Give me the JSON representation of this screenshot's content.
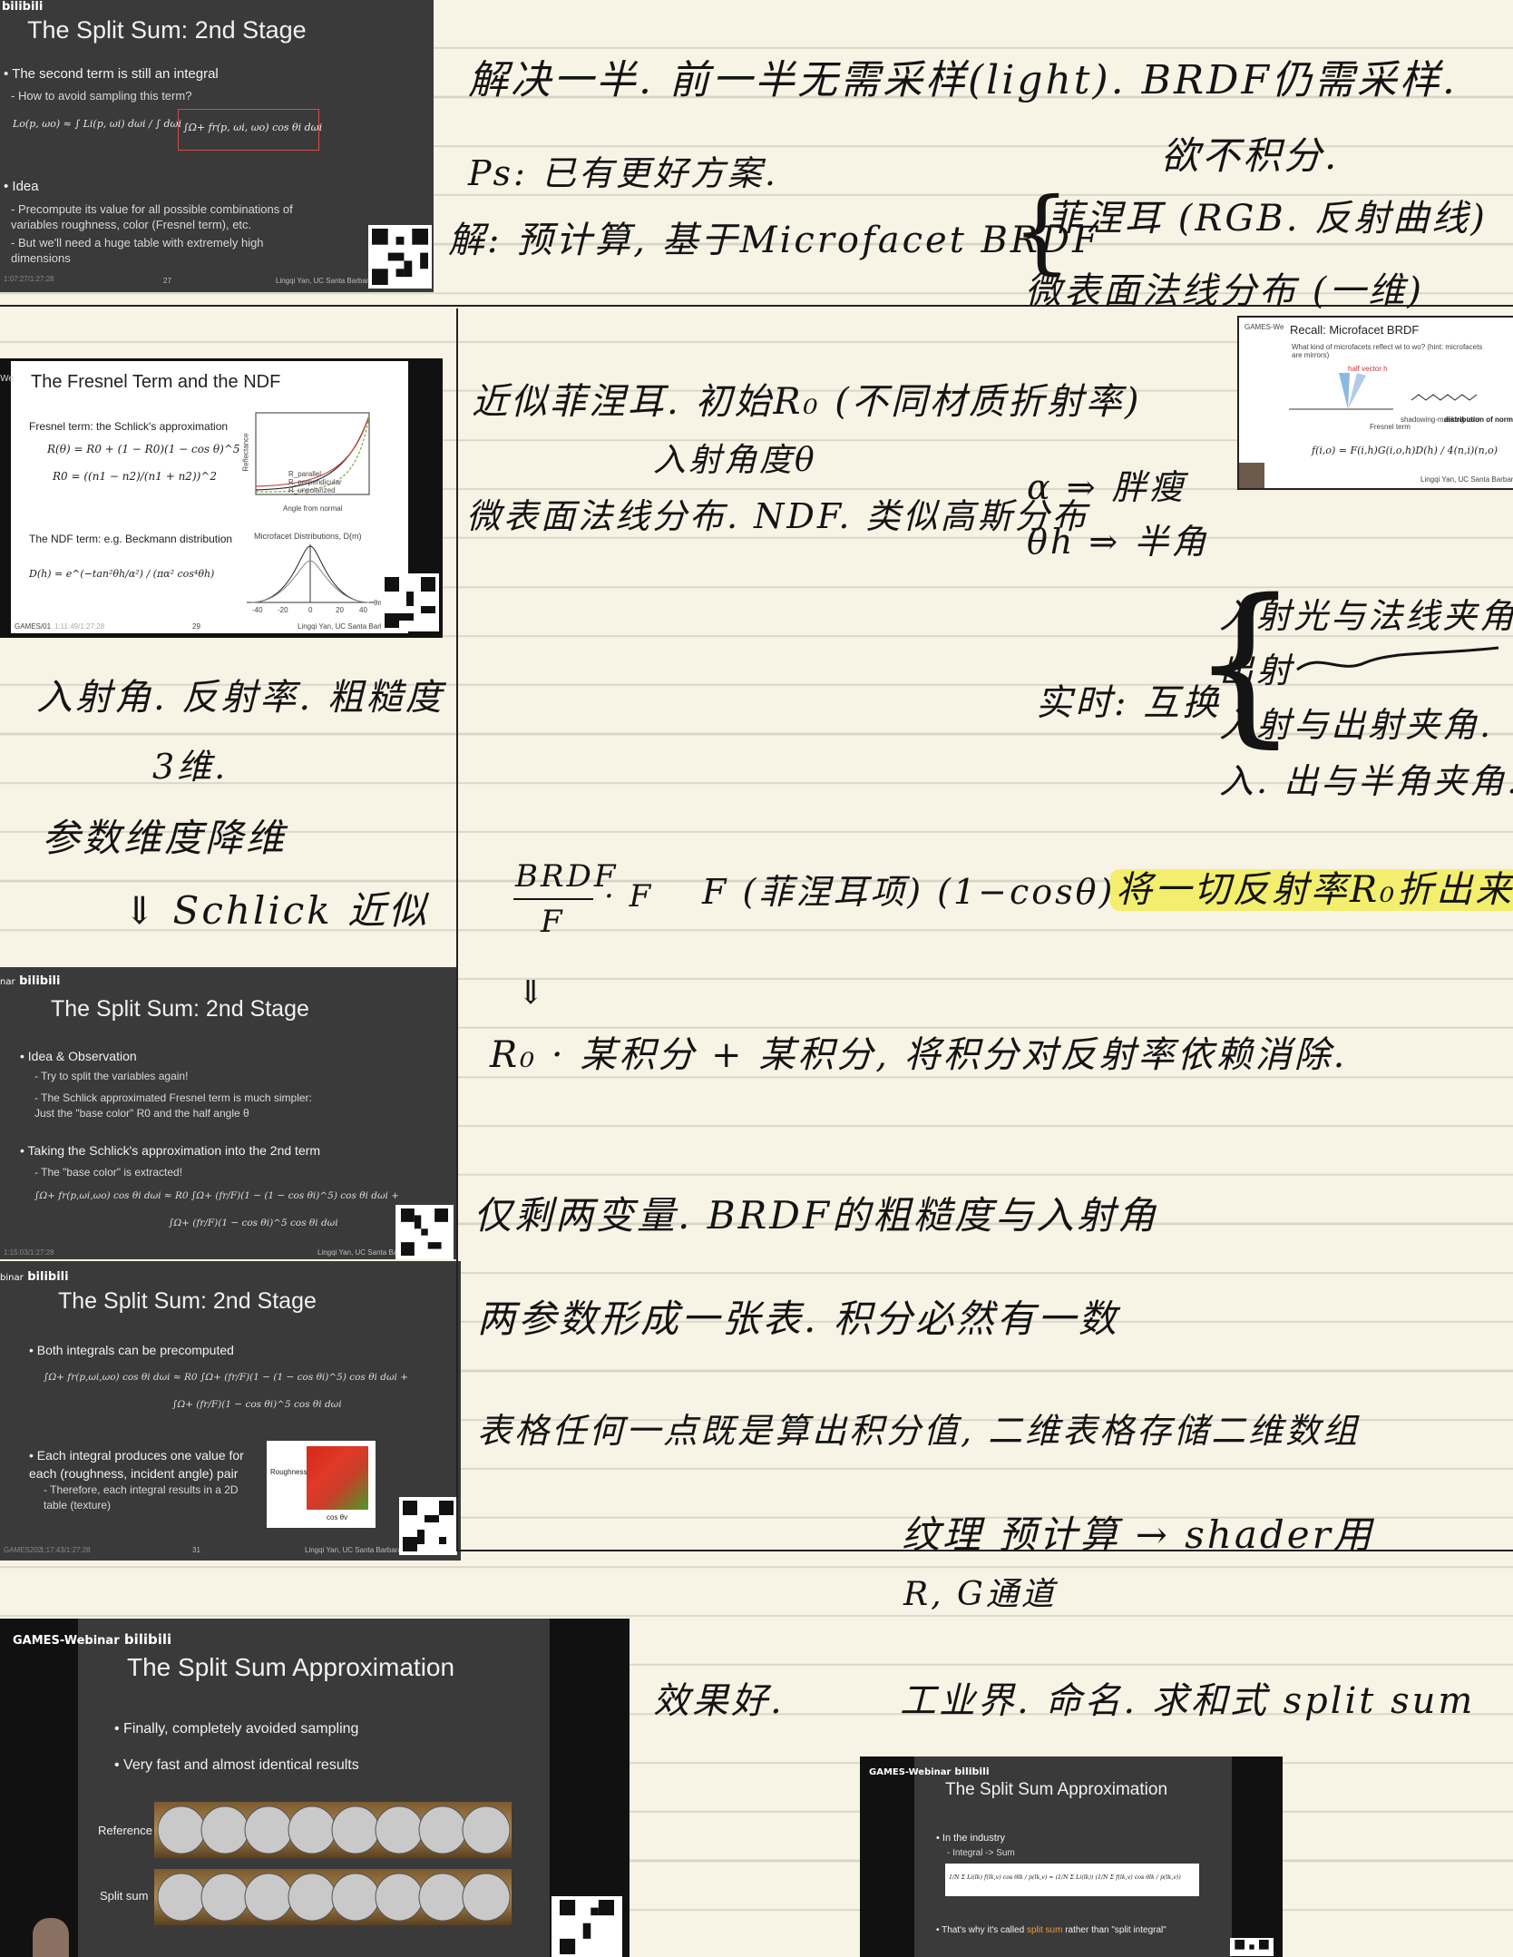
{
  "slides": {
    "s1": {
      "logo": "bilibili",
      "title": "The Split Sum: 2nd Stage",
      "b1": "The second term is still an integral",
      "b1a": "How to avoid sampling this term?",
      "formula_left": "Lo(p, ωo) ≈ ∫ Li(p, ωi) dωi / ∫ dωi",
      "formula_boxed": "∫Ω+ fr(p, ωi, ωo) cos θi dωi",
      "b2": "Idea",
      "b2a": "Precompute its value for all possible combinations of variables roughness, color (Fresnel term), etc.",
      "b2b": "But we'll need a huge table with extremely high dimensions",
      "page": "27",
      "footer": "Lingqi Yan, UC Santa Barbara",
      "time": "1:07:27/1:27:28"
    },
    "s2": {
      "title": "The Fresnel Term and the NDF",
      "fres_label": "Fresnel term: the Schlick's approximation",
      "fres_formula": "R(θ) = R0 + (1 − R0)(1 − cos θ)^5",
      "r0_formula": "R0 = ((n1 − n2)/(n1 + n2))^2",
      "ndf_label": "The NDF term: e.g. Beckmann distribution",
      "ndf_formula": "D(h) = e^(−tan²θh/α²) / (πα² cos⁴θh)",
      "plot1_legend": [
        "R_parallel",
        "R_perpendicular",
        "R_unpolarized"
      ],
      "plot1_xlabel": "Angle from normal",
      "plot1_ylabel": "Reflectance",
      "plot2_title": "Microfacet Distributions, D(m)",
      "plot2_ticks": [
        "-40",
        "-20",
        "0",
        "20",
        "40"
      ],
      "plot2_xlabel": "θm",
      "page": "29",
      "footer": "Lingqi Yan, UC Santa Barbara",
      "left_label": "We",
      "tag": "GAMES/01",
      "time": "1:11:49/1:27:28"
    },
    "s3": {
      "tag": "GAMES-We",
      "title": "Recall: Microfacet BRDF",
      "b1": "What kind of microfacets reflect wi to wo? (hint: microfacets are mirrors)",
      "hv": "half vector h",
      "labels": [
        "Fresnel term",
        "shadowing-masking term",
        "distribution of normals"
      ],
      "formula": "f(i,o) = F(i,h)G(i,o,h)D(h) / 4(n,i)(n,o)",
      "footer": "Lingqi Yan, UC Santa Barbara"
    },
    "s4": {
      "logo": "bilibili",
      "logo_prefix": "nar",
      "title": "The Split Sum: 2nd Stage",
      "b1": "Idea & Observation",
      "b1a": "Try to split the variables again!",
      "b1b": "The Schlick approximated Fresnel term is much simpler: Just the \"base color\" R0 and the half angle θ",
      "b2": "Taking the Schlick's approximation into the 2nd term",
      "b2a": "The \"base color\" is extracted!",
      "formula1": "∫Ω+ fr(p,ωi,ωo) cos θi dωi ≈ R0 ∫Ω+ (fr/F)(1 − (1 − cos θi)^5) cos θi dωi +",
      "formula2": "∫Ω+ (fr/F)(1 − cos θi)^5 cos θi dωi",
      "time": "1:15:03/1:27:28",
      "footer": "Lingqi Yan, UC Santa Barbara"
    },
    "s5": {
      "logo": "bilibili",
      "logo_prefix": "binar",
      "title": "The Split Sum: 2nd Stage",
      "b1": "Both integrals can be precomputed",
      "formula1": "∫Ω+ fr(p,ωi,ωo) cos θi dωi ≈ R0 ∫Ω+ (fr/F)(1 − (1 − cos θi)^5) cos θi dωi +",
      "formula2": "∫Ω+ (fr/F)(1 − cos θi)^5 cos θi dωi",
      "b2": "Each integral produces one value for each (roughness, incident angle) pair",
      "b2a": "Therefore, each integral results in a 2D table (texture)",
      "tex_ylabel": "Roughness",
      "tex_xlabel": "cos θv",
      "page": "31",
      "tag": "GAMES202",
      "time": "1:17:43/1:27:28",
      "footer": "Lingqi Yan, UC Santa Barbara"
    },
    "s6": {
      "logo": "bilibili",
      "logo_prefix": "GAMES-Webinar",
      "title": "The Split Sum Approximation",
      "b1": "Finally, completely avoided sampling",
      "b2": "Very fast and almost identical results",
      "row1": "Reference",
      "row2": "Split sum"
    },
    "s7": {
      "logo": "bilibili",
      "logo_prefix": "GAMES-Webinar",
      "title": "The Split Sum Approximation",
      "b1": "In the industry",
      "b1a": "Integral -> Sum",
      "formula": "1/N Σ Li(lk) f(lk,v) cos θlk / p(lk,v) ≈ (1/N Σ Li(lk)) (1/N Σ f(lk,v) cos θlk / p(lk,v))",
      "b2_pre": "That's why it's called ",
      "b2_hl": "split sum",
      "b2_post": " rather than \"split integral\""
    }
  },
  "notes": {
    "n1": "解决一半. 前一半无需采样(light). BRDF仍需采样.",
    "n2": "欲不积分.",
    "n3": "Ps: 已有更好方案.",
    "n4": "解: 预计算, 基于Microfacet BRDF",
    "n5": "菲涅耳 (RGB. 反射曲线)",
    "n6": "微表面法线分布 (一维)",
    "n7": "近似菲涅耳. 初始R₀ (不同材质折射率)",
    "n8": "入射角度θ",
    "n9": "微表面法线分布. NDF. 类似高斯分布",
    "n10": "α ⇒ 胖瘦",
    "n11": "θh ⇒ 半角",
    "n12": "入射角. 反射率. 粗糙度",
    "n13": "3维.",
    "n14": "参数维度降维",
    "n15": "⇓  Schlick 近似",
    "n16": "入射光与法线夹角",
    "n17": "出射",
    "n18": "实时: 互换",
    "n19": "入射与出射夹角.",
    "n20": "入. 出与半角夹角.",
    "n21_num": "BRDF",
    "n21_den": "F",
    "n21_dot": "· F",
    "n22": "F (菲涅耳项) (1−cosθ)⁵ ⇒",
    "n23": "将一切反射率R₀折出来",
    "n24": "⇓",
    "n25": "R₀ · 某积分 + 某积分, 将积分对反射率依赖消除.",
    "n26": "仅剩两变量. BRDF的粗糙度与入射角",
    "n27": "两参数形成一张表. 积分必然有一数",
    "n28": "表格任何一点既是算出积分值, 二维表格存储二维数组",
    "n29": "纹理 预计算 → shader用",
    "n30": "R, G通道",
    "n31": "效果好.",
    "n32": "工业界. 命名. 求和式 split sum"
  }
}
